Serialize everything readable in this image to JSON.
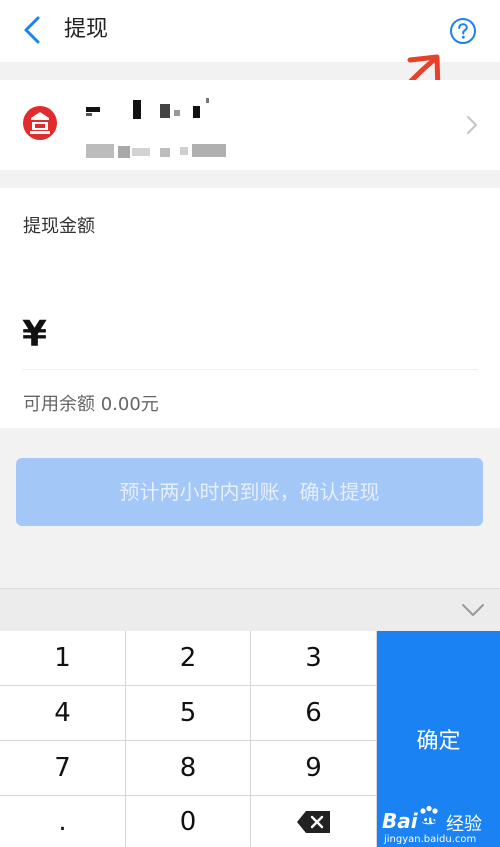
{
  "header": {
    "title": "提现",
    "back_icon": "chevron-left-icon",
    "help_icon": "question-circle-icon"
  },
  "bank_card": {
    "logo_icon": "bank-logo-icon",
    "chevron_icon": "chevron-right-icon"
  },
  "amount": {
    "label": "提现金额",
    "currency_symbol": "¥",
    "value": "",
    "balance_text": "可用余额 0.00元"
  },
  "confirm_button": {
    "label": "预计两小时内到账，确认提现"
  },
  "keyboard": {
    "collapse_icon": "chevron-down-icon",
    "keys": [
      "1",
      "2",
      "3",
      "4",
      "5",
      "6",
      "7",
      "8",
      "9",
      ".",
      "0"
    ],
    "delete_icon": "backspace-icon",
    "confirm_label": "确定"
  },
  "watermark": {
    "brand": "Bai",
    "brand2": "du",
    "cn": "经验",
    "url": "jingyan.baidu.com"
  },
  "colors": {
    "primary": "#1a82f2",
    "button_disabled": "#a3c7f7",
    "annotation_arrow": "#e8402a",
    "bank_red": "#e22b2b"
  }
}
